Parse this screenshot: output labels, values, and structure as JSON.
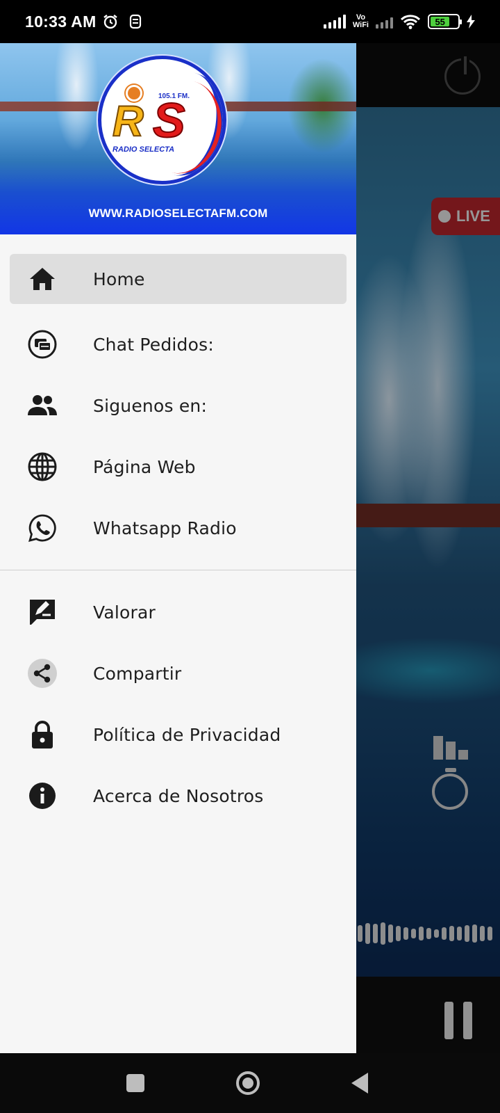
{
  "status_bar": {
    "time": "10:33 AM",
    "vowifi_line1": "Vo",
    "vowifi_line2": "WiFi",
    "battery_level": "55",
    "icons": [
      "alarm-icon",
      "notification-icon",
      "cell-signal-icon",
      "vowifi-icon",
      "cell-signal-icon",
      "wifi-icon",
      "battery-icon",
      "charging-icon"
    ]
  },
  "drawer": {
    "header_url": "WWW.RADIOSELECTAFM.COM",
    "logo": {
      "letters_r": "R",
      "letters_s": "S",
      "frequency": "105.1 FM.",
      "name": "RADIO SELECTA"
    },
    "menu_primary": [
      {
        "label": "Home",
        "icon": "home-icon",
        "active": true
      },
      {
        "label": "Chat Pedidos:",
        "icon": "chat-icon",
        "active": false
      },
      {
        "label": "Siguenos en:",
        "icon": "people-icon",
        "active": false
      },
      {
        "label": "Página Web",
        "icon": "globe-icon",
        "active": false
      },
      {
        "label": "Whatsapp Radio",
        "icon": "whatsapp-icon",
        "active": false
      }
    ],
    "menu_secondary": [
      {
        "label": "Valorar",
        "icon": "rate-icon"
      },
      {
        "label": "Compartir",
        "icon": "share-icon"
      },
      {
        "label": "Política de Privacidad",
        "icon": "lock-icon"
      },
      {
        "label": "Acerca de Nosotros",
        "icon": "info-icon"
      }
    ]
  },
  "background_app": {
    "live_label": "LIVE",
    "accent_color": "#b3242a"
  },
  "colors": {
    "drawer_bg": "#f6f6f6",
    "active_item_bg": "#dedede",
    "header_blue": "#1236e6"
  }
}
